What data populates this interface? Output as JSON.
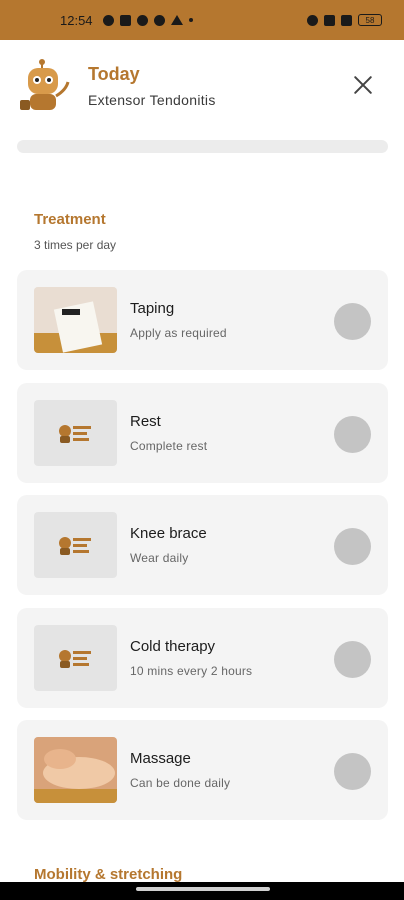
{
  "status_bar": {
    "time": "12:54",
    "battery": "58"
  },
  "header": {
    "title": "Today",
    "subtitle": "Extensor Tendonitis"
  },
  "progress": {
    "fraction": 0.0
  },
  "treatment": {
    "title": "Treatment",
    "frequency": "3 times per day",
    "items": [
      {
        "title": "Taping",
        "subtitle": "Apply as required",
        "thumb": "taping-photo"
      },
      {
        "title": "Rest",
        "subtitle": "Complete rest",
        "thumb": "placeholder-logo"
      },
      {
        "title": "Knee brace",
        "subtitle": "Wear daily",
        "thumb": "placeholder-logo"
      },
      {
        "title": "Cold therapy",
        "subtitle": "10 mins every 2 hours",
        "thumb": "placeholder-logo"
      },
      {
        "title": "Massage",
        "subtitle": "Can be done daily",
        "thumb": "massage-photo"
      }
    ]
  },
  "mobility": {
    "title": "Mobility & stretching"
  },
  "colors": {
    "accent": "#b5772f",
    "card_bg": "#f4f4f4",
    "check": "#c4c4c4"
  }
}
